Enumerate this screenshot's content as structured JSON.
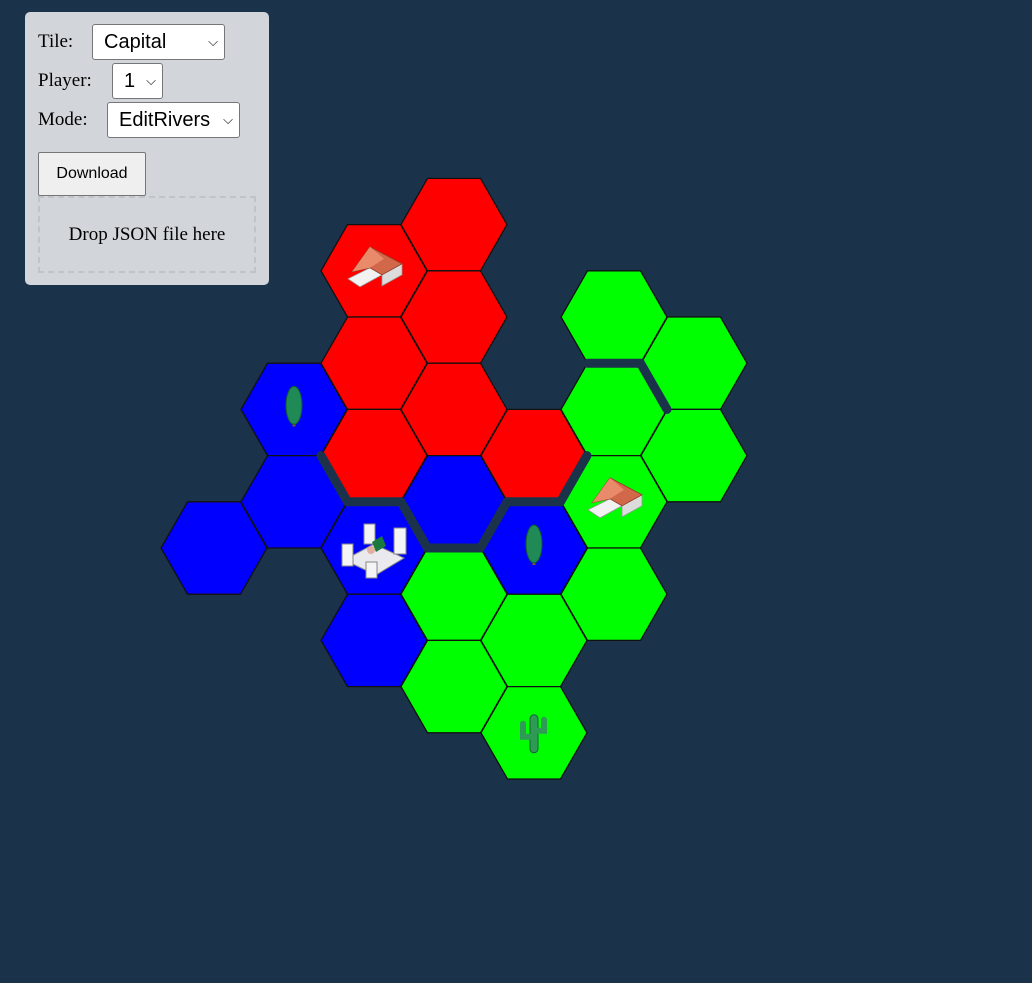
{
  "controls": {
    "tile": {
      "label": "Tile:",
      "value": "Capital"
    },
    "player": {
      "label": "Player:",
      "value": "1"
    },
    "mode": {
      "label": "Mode:",
      "value": "EditRivers"
    },
    "download_label": "Download",
    "drop_label": "Drop JSON file here"
  },
  "colors": {
    "background": "#1b324b",
    "player_red": "#ff0000",
    "player_green": "#00ff00",
    "player_blue": "#0000ff",
    "river": "#1b324b",
    "panel": "#d2d6da"
  },
  "map": {
    "tiles": [
      {
        "q": 3,
        "r": -1,
        "color": "red",
        "icon": null
      },
      {
        "q": 2,
        "r": -1,
        "color": "red",
        "icon": "village-icon"
      },
      {
        "q": 3,
        "r": 0,
        "color": "red",
        "icon": null
      },
      {
        "q": 2,
        "r": 0,
        "color": "red",
        "icon": null
      },
      {
        "q": 3,
        "r": 1,
        "color": "red",
        "icon": null
      },
      {
        "q": 2,
        "r": 1,
        "color": "red",
        "icon": null
      },
      {
        "q": 4,
        "r": 1,
        "color": "red",
        "icon": null
      },
      {
        "q": 1,
        "r": 1,
        "color": "blue",
        "icon": "tree-icon"
      },
      {
        "q": 3,
        "r": 2,
        "color": "blue",
        "icon": null
      },
      {
        "q": 0,
        "r": 2,
        "color": "blue",
        "icon": null
      },
      {
        "q": 2,
        "r": 2,
        "color": "blue",
        "icon": "castle-icon"
      },
      {
        "q": 4,
        "r": 2,
        "color": "blue",
        "icon": "tree-icon"
      },
      {
        "q": 1,
        "r": 2,
        "color": "blue",
        "icon": null
      },
      {
        "q": 2,
        "r": 3,
        "color": "blue",
        "icon": null
      },
      {
        "q": 5,
        "r": 0,
        "color": "green",
        "icon": null
      },
      {
        "q": 6,
        "r": 0,
        "color": "green",
        "icon": null
      },
      {
        "q": 5,
        "r": 1,
        "color": "green",
        "icon": null
      },
      {
        "q": 6,
        "r": 1,
        "color": "green",
        "icon": null
      },
      {
        "q": 3,
        "r": 3,
        "color": "green",
        "icon": null
      },
      {
        "q": 5,
        "r": 2,
        "color": "green",
        "icon": "village-icon"
      },
      {
        "q": 4,
        "r": 3,
        "color": "green",
        "icon": null
      },
      {
        "q": 3,
        "r": 4,
        "color": "green",
        "icon": null
      },
      {
        "q": 5,
        "r": 3,
        "color": "green",
        "icon": null
      },
      {
        "q": 4,
        "r": 4,
        "color": "green",
        "icon": "cactus-icon"
      }
    ],
    "rivers": [
      {
        "q": 2,
        "r": 1,
        "edge": "bottom-left"
      },
      {
        "q": 2,
        "r": 1,
        "edge": "bottom"
      },
      {
        "q": 3,
        "r": 2,
        "edge": "bottom-left"
      },
      {
        "q": 3,
        "r": 2,
        "edge": "bottom"
      },
      {
        "q": 3,
        "r": 2,
        "edge": "bottom-right"
      },
      {
        "q": 4,
        "r": 1,
        "edge": "bottom"
      },
      {
        "q": 4,
        "r": 1,
        "edge": "bottom-right"
      },
      {
        "q": 5,
        "r": 1,
        "edge": "top"
      },
      {
        "q": 5,
        "r": 1,
        "edge": "top-right"
      }
    ]
  }
}
